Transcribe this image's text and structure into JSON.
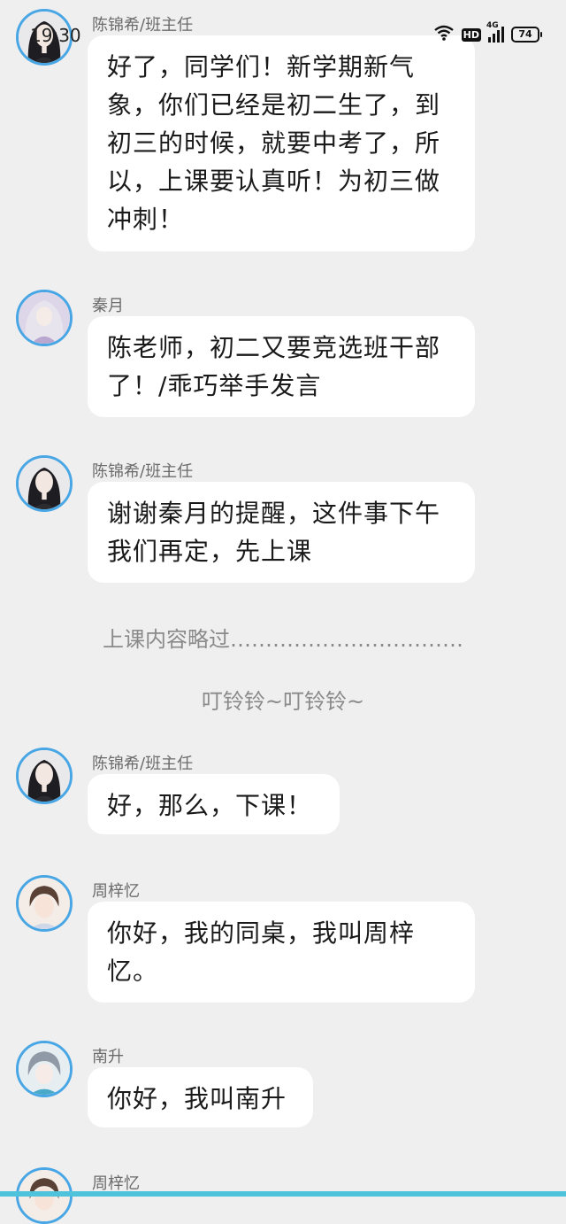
{
  "status_bar": {
    "time": "19:30",
    "network_label": "4G",
    "hd_label": "HD",
    "battery": "74",
    "icons": [
      "wifi-icon",
      "hd-icon",
      "signal-icon",
      "battery-icon"
    ]
  },
  "messages": [
    {
      "sender": "陈锦希/班主任",
      "avatar": "teacher-avatar",
      "text": "好了，同学们！新学期新气象，你们已经是初二生了，到初三的时候，就要中考了，所以，上课要认真听！为初三做冲刺！"
    },
    {
      "sender": "秦月",
      "avatar": "qinyue-avatar",
      "text": "陈老师，初二又要竞选班干部了！/乖巧举手发言"
    },
    {
      "sender": "陈锦希/班主任",
      "avatar": "teacher-avatar",
      "text": "谢谢秦月的提醒，这件事下午我们再定，先上课"
    },
    {
      "sender": "陈锦希/班主任",
      "avatar": "teacher-avatar",
      "text": "好，那么，下课！"
    },
    {
      "sender": "周梓忆",
      "avatar": "zhouziyi-avatar",
      "text": "你好，我的同桌，我叫周梓忆。"
    },
    {
      "sender": "南升",
      "avatar": "nansheng-avatar",
      "text": "你好，我叫南升"
    },
    {
      "sender": "周梓忆",
      "avatar": "zhouziyi-avatar",
      "text": ""
    }
  ],
  "narration": [
    "上课内容略过……………………………",
    "叮铃铃~叮铃铃~"
  ],
  "colors": {
    "background": "#efefef",
    "bubble": "#ffffff",
    "avatar_ring": "#49a6e5",
    "bottom_accent": "#4fc3dc"
  }
}
